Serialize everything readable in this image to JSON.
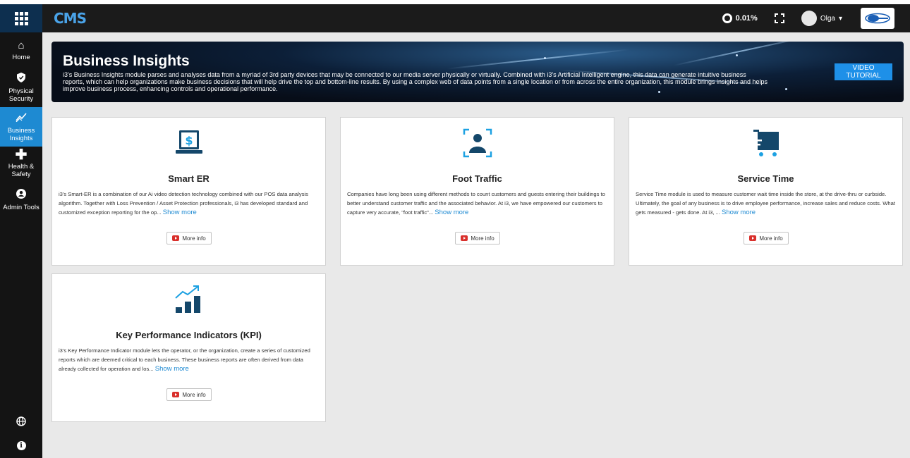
{
  "header": {
    "logo": "CMS",
    "usage": "0.01%",
    "user_name": "Olga",
    "user_caret": "▾"
  },
  "sidebar": {
    "items": [
      {
        "label": "Home",
        "icon": "home-icon"
      },
      {
        "label": "Physical Security",
        "icon": "shield-icon"
      },
      {
        "label": "Business Insights",
        "icon": "chart-icon",
        "active": true
      },
      {
        "label": "Health & Safety",
        "icon": "plus-icon"
      },
      {
        "label": "Admin Tools",
        "icon": "user-icon"
      }
    ],
    "bottom": [
      {
        "icon": "globe-icon"
      },
      {
        "icon": "info-icon",
        "glyph": "i"
      }
    ]
  },
  "banner": {
    "title": "Business Insights",
    "text": "i3's Business Insights module parses and analyses data from a myriad of 3rd party devices that may be connected to our media server physically or virtually. Combined with i3's Artificial Intelligent engine, this data can generate intuitive business reports, which can help organizations make business decisions that will help drive the top and bottom-line results. By using a complex web of data points from a single location or from across the entire organization, this module brings insights and helps improve business process, enhancing controls and operational performance.",
    "button": "VIDEO TUTORIAL"
  },
  "cards": [
    {
      "title": "Smart ER",
      "icon": "laptop-dollar-icon",
      "desc": "i3's Smart-ER is a combination of our Ai video detection technology combined with our POS data analysis algorithm. Together with Loss Prevention / Asset Protection professionals, i3 has developed standard and customized exception reporting for the op...",
      "show_more": "Show more",
      "button": "More info"
    },
    {
      "title": "Foot Traffic",
      "icon": "person-focus-icon",
      "desc": "Companies have long been using different methods to count customers and guests entering their buildings to better understand customer traffic and the associated behavior. At i3, we have empowered our customers to capture very accurate, \"foot traffic\"...",
      "show_more": "Show more",
      "button": "More info"
    },
    {
      "title": "Service Time",
      "icon": "cart-icon",
      "desc": "Service Time module is used to measure customer wait time inside the store, at the drive-thru or curbside. Ultimately, the goal of any business is to drive employee performance, increase sales and reduce costs. What gets measured - gets done. At i3, ...",
      "show_more": "Show more",
      "button": "More info"
    },
    {
      "title": "Key Performance Indicators (KPI)",
      "icon": "bar-chart-trend-icon",
      "desc": "i3's Key Performance Indicator module lets the operator, or the organization, create a series of customized reports which are deemed critical to each business. These business reports are often derived from data already collected for operation and los...",
      "show_more": "Show more",
      "button": "More info"
    }
  ],
  "colors": {
    "accent": "#1e8ad2",
    "icon_dark": "#14476a",
    "cart_blue": "#1da1e2"
  }
}
